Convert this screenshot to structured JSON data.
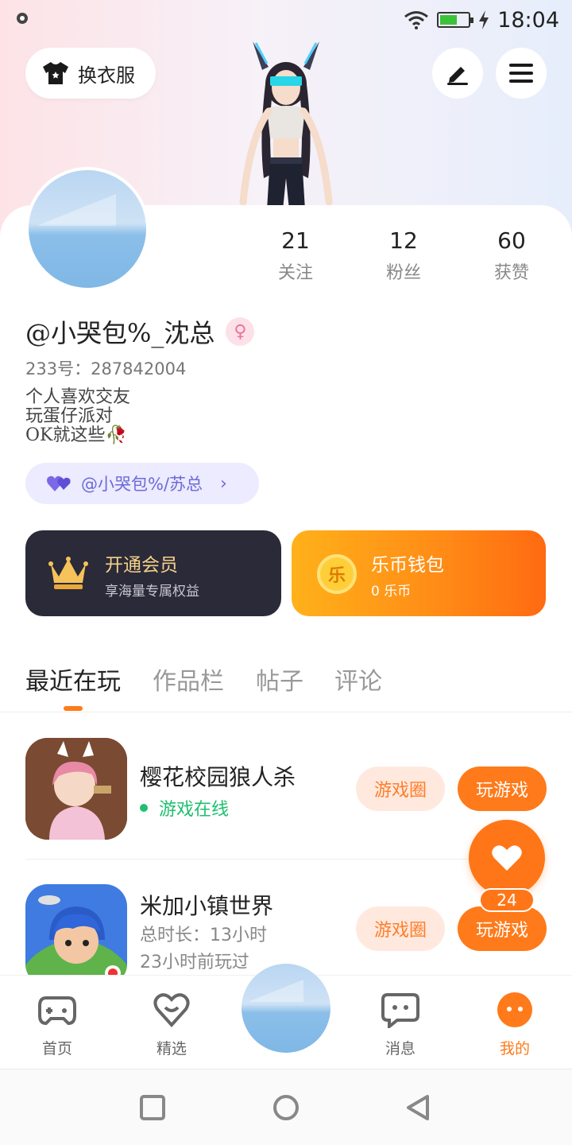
{
  "status_bar": {
    "time": "18:04",
    "battery_level": 0.6
  },
  "header": {
    "wardrobe_label": "换衣服",
    "edit_icon": "pen-icon",
    "menu_icon": "hamburger-icon"
  },
  "profile": {
    "username": "@小哭包%_沈总",
    "gender_symbol": "♀",
    "uid": "233号：287842004",
    "bio": [
      "个人喜欢交友",
      "玩蛋仔派对",
      "OK就这些🥀"
    ],
    "cp_tag": "@小哭包%/苏总"
  },
  "stats": [
    {
      "num": "21",
      "label": "关注"
    },
    {
      "num": "12",
      "label": "粉丝"
    },
    {
      "num": "60",
      "label": "获赞"
    }
  ],
  "vip": {
    "title": "开通会员",
    "subtitle": "享海量专属权益"
  },
  "wallet": {
    "title": "乐币钱包",
    "subtitle": "0 乐币",
    "coin_char": "乐"
  },
  "tabs": [
    "最近在玩",
    "作品栏",
    "帖子",
    "评论"
  ],
  "games": [
    {
      "name": "樱花校园狼人杀",
      "status": "游戏在线",
      "circle_label": "游戏圈",
      "play_label": "玩游戏"
    },
    {
      "name": "米加小镇世界",
      "duration": "总时长：13小时",
      "last_played": "23小时前玩过",
      "circle_label": "游戏圈",
      "play_label": "玩游戏"
    }
  ],
  "fab": {
    "count": "24"
  },
  "bottom_nav": [
    {
      "label": "首页"
    },
    {
      "label": "精选"
    },
    {
      "label": "消息"
    },
    {
      "label": "我的"
    }
  ],
  "colors": {
    "accent": "#ff7a1a",
    "vip_bg": "#2b2a39",
    "online": "#1fbf6f"
  }
}
